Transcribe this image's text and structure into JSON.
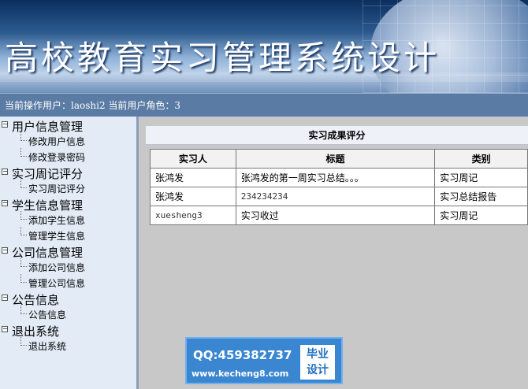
{
  "banner": {
    "title": "高校教育实习管理系统设计"
  },
  "userbar": {
    "text": "当前操作用户：laoshi2 当前用户角色：3"
  },
  "sidebar": {
    "groups": [
      {
        "label": "用户信息管理",
        "items": [
          "修改用户信息",
          "修改登录密码"
        ]
      },
      {
        "label": "实习周记评分",
        "items": [
          "实习周记评分"
        ]
      },
      {
        "label": "学生信息管理",
        "items": [
          "添加学生信息",
          "管理学生信息"
        ]
      },
      {
        "label": "公司信息管理",
        "items": [
          "添加公司信息",
          "管理公司信息"
        ]
      },
      {
        "label": "公告信息",
        "items": [
          "公告信息"
        ]
      },
      {
        "label": "退出系统",
        "items": [
          "退出系统"
        ]
      }
    ]
  },
  "panel": {
    "title": "实习成果评分",
    "columns": [
      "实习人",
      "标题",
      "类别"
    ],
    "rows": [
      [
        "张鸿发",
        "张鸿发的第一周实习总结。。。",
        "实习周记"
      ],
      [
        "张鸿发",
        "234234234",
        "实习总结报告"
      ],
      [
        "xuesheng3",
        "实习收过",
        "实习周记"
      ]
    ]
  },
  "watermark": {
    "qq": "QQ:459382737",
    "url": "www.kecheng8.com",
    "badge_line1": "毕业",
    "badge_line2": "设计"
  }
}
